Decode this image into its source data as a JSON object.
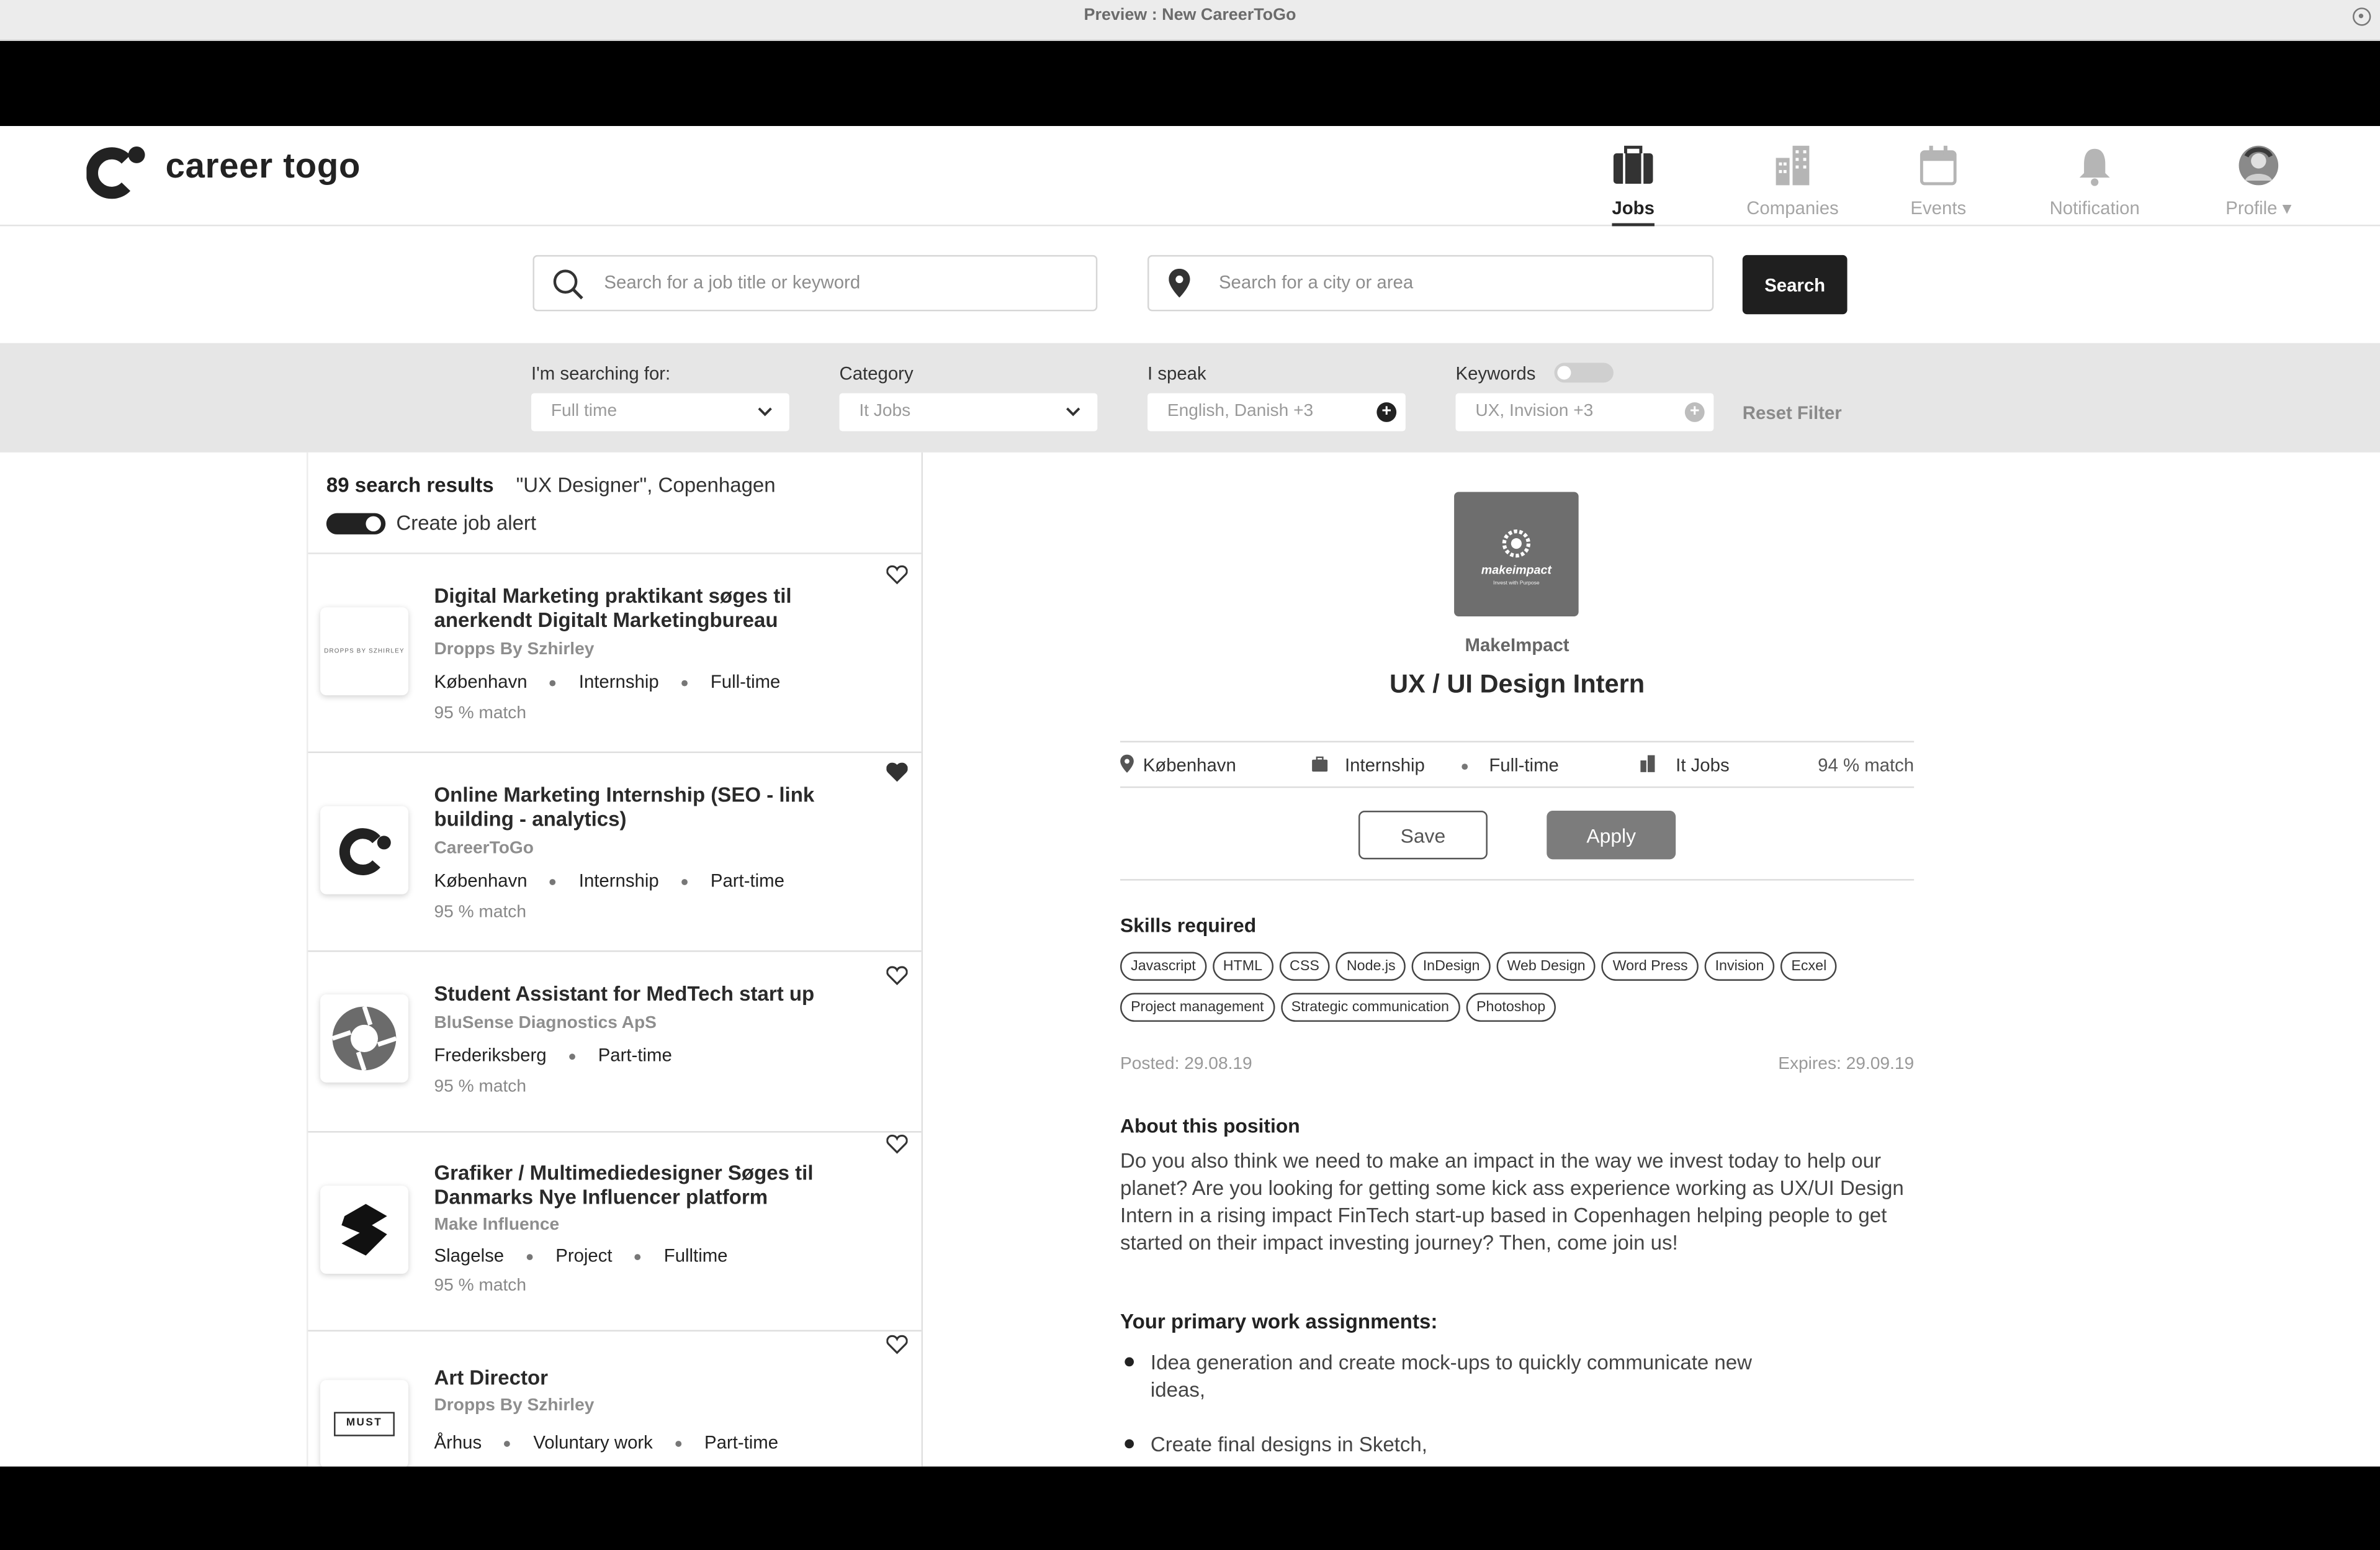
{
  "window": {
    "title": "Preview : New CareerToGo"
  },
  "brand": {
    "name": "career togo"
  },
  "nav": [
    {
      "label": "Jobs",
      "icon": "briefcase-icon",
      "active": true
    },
    {
      "label": "Companies",
      "icon": "building-icon"
    },
    {
      "label": "Events",
      "icon": "calendar-icon"
    },
    {
      "label": "Notification",
      "icon": "bell-icon"
    },
    {
      "label": "Profile ▾",
      "icon": "avatar"
    }
  ],
  "search": {
    "keyword_placeholder": "Search for a job title or keyword",
    "location_placeholder": "Search for a city or area",
    "button": "Search"
  },
  "filters": {
    "searching_for": {
      "label": "I'm searching for:",
      "value": "Full time"
    },
    "category": {
      "label": "Category",
      "value": "It Jobs"
    },
    "languages": {
      "label": "I speak",
      "value": "English, Danish +3"
    },
    "keywords": {
      "label": "Keywords",
      "value": "UX, Invision +3",
      "toggle_on": false
    },
    "reset": "Reset Filter"
  },
  "results": {
    "count": "89 search results",
    "query": "\"UX Designer\", Copenhagen",
    "alert_label": "Create job alert",
    "alert_on": true,
    "items": [
      {
        "title": "Digital Marketing praktikant søges til anerkendt Digitalt Marketingbureau",
        "company": "Dropps By Szhirley",
        "location": "København",
        "type": "Internship",
        "time": "Full-time",
        "match": "95 % match",
        "logo_text": "DROPPS BY SZHIRLEY",
        "saved": false
      },
      {
        "title": "Online Marketing Internship (SEO - link building - analytics)",
        "company": "CareerToGo",
        "location": "København",
        "type": "Internship",
        "time": "Part-time",
        "match": "95 % match",
        "saved": true
      },
      {
        "title": "Student Assistant for MedTech start up",
        "company": "BluSense Diagnostics ApS",
        "location": "Frederiksberg",
        "time": "Part-time",
        "match": "95 % match",
        "saved": false
      },
      {
        "title": "Grafiker / Multimediedesigner Søges til Danmarks Nye Influencer platform",
        "company": "Make Influence",
        "location": "Slagelse",
        "type": "Project",
        "time": "Fulltime",
        "match": "95 % match",
        "saved": false
      },
      {
        "title": "Art Director",
        "company": "Dropps By Szhirley",
        "location": "Århus",
        "type": "Voluntary work",
        "time": "Part-time",
        "logo_text": "MUST",
        "saved": false
      }
    ]
  },
  "detail": {
    "company": "MakeImpact",
    "logo_text": "makeimpact",
    "logo_tagline": "Invest with Purpose",
    "title": "UX / UI Design Intern",
    "location": "København",
    "type": "Internship",
    "time": "Full-time",
    "category": "It Jobs",
    "match": "94 % match",
    "save": "Save",
    "apply": "Apply",
    "skills_heading": "Skills required",
    "skills": [
      "Javascript",
      "HTML",
      "CSS",
      "Node.js",
      "InDesign",
      "Web Design",
      "Word Press",
      "Invision",
      "Ecxel",
      "Project management",
      "Strategic communication",
      "Photoshop"
    ],
    "posted": "Posted: 29.08.19",
    "expires": "Expires: 29.09.19",
    "about_heading": "About this position",
    "about_text": "Do you also think we need to make an impact in the way we invest today to help our planet? Are you looking for getting some kick ass experience working as UX/UI Design Intern in a rising impact FinTech start-up based in Copenhagen helping people to get started on their impact investing journey? Then, come join us!",
    "tasks_heading": "Your primary work assignments:",
    "tasks": [
      "Idea generation and create mock-ups to quickly communicate new ideas,",
      "Create final designs in Sketch,"
    ]
  },
  "colors": {
    "accent": "#1f1f1f",
    "muted": "#8e8e8e",
    "filter_bar": "#e6e6e6",
    "apply_button": "#7c7c7c"
  }
}
